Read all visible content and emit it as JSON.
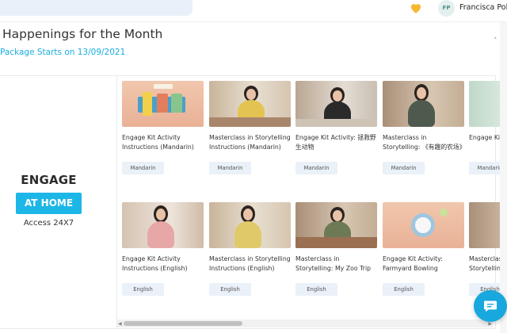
{
  "header": {
    "user_initials": "FP",
    "user_name": "Francisca Poh"
  },
  "page": {
    "title": "Happenings for the Month",
    "subtitle": "Package Starts on 13/09/2021"
  },
  "engage": {
    "heading": "ENGAGE",
    "badge": "AT HOME",
    "access": "Access 24X7"
  },
  "cards": [
    {
      "title": "Engage Kit Activity Instructions (Mandarin)",
      "tag": "Mandarin"
    },
    {
      "title": "Masterclass in Storytelling Instructions (Mandarin)",
      "tag": "Mandarin"
    },
    {
      "title": "Engage Kit Activity: 拯救野生动物",
      "tag": "Mandarin"
    },
    {
      "title": "Masterclass in Storytelling: 《有趣的农场》",
      "tag": "Mandarin"
    },
    {
      "title": "Engage Kit Activity: 动物",
      "tag": "Mandarin"
    },
    {
      "title": "Engage Kit Activity Instructions (English)",
      "tag": "English"
    },
    {
      "title": "Masterclass in Storytelling Instructions (English)",
      "tag": "English"
    },
    {
      "title": "Masterclass in Storytelling: My Zoo Trip",
      "tag": "English"
    },
    {
      "title": "Engage Kit Activity: Farmyard Bowling",
      "tag": "English"
    },
    {
      "title": "Masterclass in Storytelling: Our Unc",
      "tag": "English"
    }
  ],
  "colors": {
    "accent": "#1cb7e6",
    "subtitle": "#19aee0",
    "tag_bg": "#eaf1f8"
  },
  "icons": {
    "heart": "heart-icon",
    "chat": "chat-icon"
  }
}
